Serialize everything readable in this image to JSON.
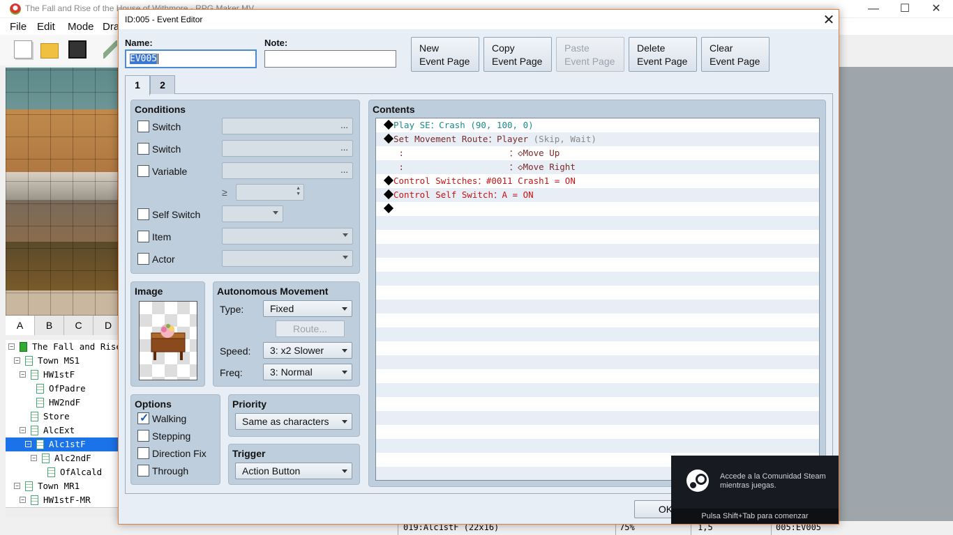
{
  "app": {
    "title": "The Fall and Rise of the House of Withmore - RPG Maker MV",
    "menu": [
      "File",
      "Edit",
      "Mode",
      "Dra"
    ],
    "tileset_tabs": [
      "A",
      "B",
      "C",
      "D"
    ],
    "map_tree": [
      {
        "label": "The Fall and Rise",
        "indent": 0,
        "expander": "−",
        "root": true
      },
      {
        "label": "Town MS1",
        "indent": 1,
        "expander": "−"
      },
      {
        "label": "HW1stF",
        "indent": 2,
        "expander": "−"
      },
      {
        "label": "OfPadre",
        "indent": 3,
        "expander": ""
      },
      {
        "label": "HW2ndF",
        "indent": 3,
        "expander": ""
      },
      {
        "label": "Store",
        "indent": 2,
        "expander": ""
      },
      {
        "label": "AlcExt",
        "indent": 2,
        "expander": "−"
      },
      {
        "label": "Alc1stF",
        "indent": 3,
        "expander": "−",
        "selected": true
      },
      {
        "label": "Alc2ndF",
        "indent": 4,
        "expander": "−"
      },
      {
        "label": "OfAlcald",
        "indent": 5,
        "expander": ""
      },
      {
        "label": "Town MR1",
        "indent": 1,
        "expander": "−"
      },
      {
        "label": "HW1stF-MR",
        "indent": 2,
        "expander": "−"
      }
    ],
    "status": {
      "map": "019:Alc1stF (22x16)",
      "zoom": "75%",
      "coords": "1,5",
      "event": "005:EV005"
    }
  },
  "dialog": {
    "title": "ID:005 - Event Editor",
    "close": "✕",
    "name_label": "Name:",
    "name_value": "EV005",
    "note_label": "Note:",
    "note_value": "",
    "buttons": {
      "new": [
        "New",
        "Event Page"
      ],
      "copy": [
        "Copy",
        "Event Page"
      ],
      "paste": [
        "Paste",
        "Event Page"
      ],
      "delete": [
        "Delete",
        "Event Page"
      ],
      "clear": [
        "Clear",
        "Event Page"
      ]
    },
    "page_tabs": [
      "1",
      "2"
    ],
    "active_page": "1",
    "conditions": {
      "title": "Conditions",
      "switch1": "Switch",
      "switch2": "Switch",
      "variable": "Variable",
      "ge_symbol": "≥",
      "self_switch": "Self Switch",
      "item": "Item",
      "actor": "Actor",
      "dots": "..."
    },
    "image": {
      "title": "Image"
    },
    "autonomous": {
      "title": "Autonomous Movement",
      "type_label": "Type:",
      "type_value": "Fixed",
      "route_button": "Route...",
      "speed_label": "Speed:",
      "speed_value": "3: x2 Slower",
      "freq_label": "Freq:",
      "freq_value": "3: Normal"
    },
    "options": {
      "title": "Options",
      "walking": "Walking",
      "walking_checked": true,
      "stepping": "Stepping",
      "direction_fix": "Direction Fix",
      "through": "Through"
    },
    "priority": {
      "title": "Priority",
      "value": "Same as characters"
    },
    "trigger": {
      "title": "Trigger",
      "value": "Action Button"
    },
    "contents": {
      "title": "Contents",
      "lines": [
        {
          "bullet": true,
          "parts": [
            {
              "t": "Play SE：Crash (90, 100, 0)",
              "c": "c-teal"
            }
          ]
        },
        {
          "bullet": true,
          "parts": [
            {
              "t": "Set Movement Route：",
              "c": "c-brown"
            },
            {
              "t": "Player",
              "c": "c-brown"
            },
            {
              "t": " (Skip, Wait)",
              "c": "c-gray"
            }
          ]
        },
        {
          "bullet": false,
          "parts": [
            {
              "t": " :                    ：◇Move Up",
              "c": "c-brown"
            }
          ]
        },
        {
          "bullet": false,
          "parts": [
            {
              "t": " :                    ：◇Move Right",
              "c": "c-brown"
            }
          ]
        },
        {
          "bullet": true,
          "parts": [
            {
              "t": "Control Switches：#0011 Crash1 = ON",
              "c": "c-red"
            }
          ]
        },
        {
          "bullet": true,
          "parts": [
            {
              "t": "Control Self Switch：A = ON",
              "c": "c-red"
            }
          ]
        },
        {
          "bullet": true,
          "parts": [
            {
              "t": "",
              "c": "c-blk"
            }
          ]
        }
      ]
    },
    "ok": "OK"
  },
  "steam": {
    "message": "Accede a la Comunidad Steam mientras juegas.",
    "footer": "Pulsa Shift+Tab para comenzar"
  }
}
